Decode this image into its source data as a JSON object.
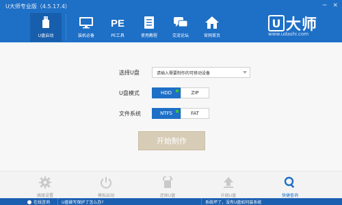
{
  "window": {
    "title": "U大师专业版（4.5.17.4）",
    "controls": [
      "−",
      "×"
    ]
  },
  "nav": {
    "items": [
      {
        "label": "U盘启动",
        "icon": "usb-drive-icon",
        "active": true
      },
      {
        "label": "装机必备",
        "icon": "monitor-icon",
        "active": false
      },
      {
        "label": "PE工具",
        "icon": "pe-icon",
        "active": false
      },
      {
        "label": "使用教程",
        "icon": "document-icon",
        "active": false
      },
      {
        "label": "交流论坛",
        "icon": "forum-icon",
        "active": false
      },
      {
        "label": "官网首页",
        "icon": "home-icon",
        "active": false
      }
    ]
  },
  "logo": {
    "mark": "U",
    "text": "大师",
    "url": "www.udashi.com"
  },
  "form": {
    "u_label": "选择U盘",
    "u_select_value": "请插入需要制作的可移动设备",
    "mode_label": "U盘模式",
    "mode_options": [
      "HDD",
      "ZIP"
    ],
    "mode_selected": "HDD",
    "fs_label": "文件系统",
    "fs_options": [
      "NTFS",
      "FAT"
    ],
    "fs_selected": "NTFS",
    "start_button": "开始制作"
  },
  "toolbar": {
    "items": [
      {
        "label": "高级设置",
        "icon": "gear-icon",
        "active": false
      },
      {
        "label": "模拟启动",
        "icon": "power-icon",
        "active": false
      },
      {
        "label": "还原U盘",
        "icon": "restore-icon",
        "active": false
      },
      {
        "label": "升级U盘",
        "icon": "upgrade-icon",
        "active": false
      },
      {
        "label": "快捷查询",
        "icon": "search-icon",
        "active": true
      }
    ]
  },
  "status": {
    "online": "在线咨询",
    "question": "U盘被写保护了怎么办?",
    "system": "系统坏了，没有U盘如何装系统"
  },
  "colors": {
    "header": "#1e6fc6",
    "active_nav": "#175ead",
    "status_bar": "#1a5fb0",
    "start_button": "#d7ccb6"
  }
}
